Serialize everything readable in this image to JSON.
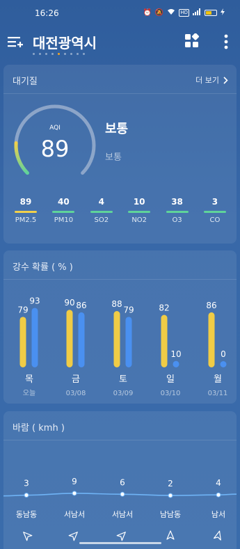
{
  "status_bar": {
    "time": "16:26"
  },
  "header": {
    "city": "대전광역시",
    "page_count": 9,
    "active_page": 5
  },
  "air_quality": {
    "title": "대기질",
    "more_label": "더 보기",
    "aqi_label": "AQI",
    "aqi_value": "89",
    "status": "보통",
    "status_sub": "보통",
    "gauge_fraction": 0.18,
    "pollutants": [
      {
        "name": "PM2.5",
        "value": "89",
        "color": "#f1d04b"
      },
      {
        "name": "PM10",
        "value": "40",
        "color": "#5fd39a"
      },
      {
        "name": "SO2",
        "value": "4",
        "color": "#5fd39a"
      },
      {
        "name": "NO2",
        "value": "10",
        "color": "#5fd39a"
      },
      {
        "name": "O3",
        "value": "38",
        "color": "#5fd39a"
      },
      {
        "name": "CO",
        "value": "3",
        "color": "#5fd39a"
      }
    ]
  },
  "precipitation": {
    "title": "강수 확률 ( % )",
    "colors": {
      "day": "#f0cc46",
      "night": "#4a90f0"
    },
    "days": [
      {
        "day": "목",
        "date": "오늘",
        "a": 79,
        "b": 93
      },
      {
        "day": "금",
        "date": "03/08",
        "a": 90,
        "b": 86
      },
      {
        "day": "토",
        "date": "03/09",
        "a": 88,
        "b": 79
      },
      {
        "day": "일",
        "date": "03/10",
        "a": 82,
        "b": 10
      },
      {
        "day": "월",
        "date": "03/11",
        "a": 86,
        "b": 0
      }
    ]
  },
  "wind": {
    "title": "바람 ( kmh )",
    "points": [
      {
        "speed": 3,
        "direction": "동남동",
        "arrow_deg": 315
      },
      {
        "speed": 9,
        "direction": "서남서",
        "arrow_deg": 45
      },
      {
        "speed": 6,
        "direction": "서남서",
        "arrow_deg": 45
      },
      {
        "speed": 2,
        "direction": "남남동",
        "arrow_deg": 0
      },
      {
        "speed": 4,
        "direction": "남서",
        "arrow_deg": 15
      }
    ]
  }
}
